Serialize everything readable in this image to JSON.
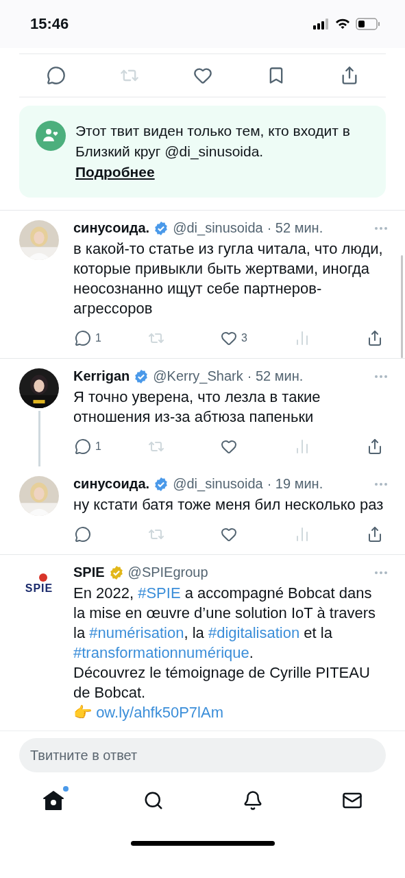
{
  "status_bar": {
    "time": "15:46"
  },
  "main_actions": [
    {
      "kind": "reply",
      "disabled": false
    },
    {
      "kind": "retweet",
      "disabled": true
    },
    {
      "kind": "like",
      "disabled": false
    },
    {
      "kind": "bookmark",
      "disabled": false
    },
    {
      "kind": "share",
      "disabled": false
    }
  ],
  "notice": {
    "text": "Этот твит виден только тем, кто входит в Близкий круг @di_sinusoida.",
    "link": "Подробнее"
  },
  "tweets": [
    {
      "name": "синусоида.",
      "badge": {
        "color": "#4a99e9"
      },
      "handle": "@di_sinusoida",
      "time": "· 52 мин.",
      "thread_continues": false,
      "divider_after": true,
      "body": [
        {
          "kind": "text",
          "text": "в какой-то статье из гугла читала, что люди, которые привыкли быть жертвами, иногда неосознанно ищут себе партнеров-агрессоров"
        }
      ],
      "actions": [
        {
          "kind": "reply",
          "count": "1",
          "disabled": false
        },
        {
          "kind": "retweet",
          "disabled": true
        },
        {
          "kind": "like",
          "count": "3",
          "disabled": false
        },
        {
          "kind": "views",
          "disabled": true
        },
        {
          "kind": "share",
          "disabled": false
        }
      ]
    },
    {
      "name": "Kerrigan",
      "badge": {
        "color": "#4a99e9"
      },
      "handle": "@Kerry_Shark",
      "time": "· 52 мин.",
      "thread_continues": true,
      "divider_after": false,
      "body": [
        {
          "kind": "text",
          "text": "Я точно уверена, что лезла в такие отношения из-за абтюза папеньки"
        }
      ],
      "actions": [
        {
          "kind": "reply",
          "count": "1",
          "disabled": false
        },
        {
          "kind": "retweet",
          "disabled": true
        },
        {
          "kind": "like",
          "disabled": false
        },
        {
          "kind": "views",
          "disabled": true
        },
        {
          "kind": "share",
          "disabled": false
        }
      ]
    },
    {
      "name": "синусоида.",
      "badge": {
        "color": "#4a99e9"
      },
      "handle": "@di_sinusoida",
      "time": "· 19 мин.",
      "thread_continues": false,
      "divider_after": true,
      "body": [
        {
          "kind": "text",
          "text": "ну кстати батя тоже меня бил несколько раз"
        }
      ],
      "actions": [
        {
          "kind": "reply",
          "disabled": false
        },
        {
          "kind": "retweet",
          "disabled": true
        },
        {
          "kind": "like",
          "disabled": false
        },
        {
          "kind": "views",
          "disabled": true
        },
        {
          "kind": "share",
          "disabled": false
        }
      ]
    },
    {
      "avatar": {
        "kind": "logo",
        "text": "SPIE"
      },
      "name": "SPIE",
      "badge": {
        "color": "#e2b719"
      },
      "handle": "@SPIEgroup",
      "thread_continues": false,
      "divider_after": true,
      "body": [
        {
          "kind": "text",
          "text": "En 2022, "
        },
        {
          "kind": "hashtag",
          "text": "#SPIE"
        },
        {
          "kind": "text",
          "text": " a accompagné Bobcat dans la mise en œuvre d’une solution IoT à travers la "
        },
        {
          "kind": "hashtag",
          "text": "#numérisation"
        },
        {
          "kind": "text",
          "text": ", la "
        },
        {
          "kind": "hashtag",
          "text": "#digitalisation"
        },
        {
          "kind": "text",
          "text": " et la "
        },
        {
          "kind": "hashtag",
          "text": "#transformationnumérique"
        },
        {
          "kind": "text",
          "text": ".\nDécouvrez le témoignage de Cyrille PITEAU de Bobcat.\n👉 "
        },
        {
          "kind": "link",
          "text": "ow.ly/ahfk50P7lAm"
        }
      ]
    }
  ],
  "composer": {
    "placeholder": "Твитните в ответ"
  },
  "bottom_nav": [
    {
      "kind": "home",
      "selected": true,
      "has_update": true
    },
    {
      "kind": "search",
      "selected": false,
      "has_update": false
    },
    {
      "kind": "notifications",
      "selected": false,
      "has_update": false
    },
    {
      "kind": "messages",
      "selected": false,
      "has_update": false
    }
  ]
}
